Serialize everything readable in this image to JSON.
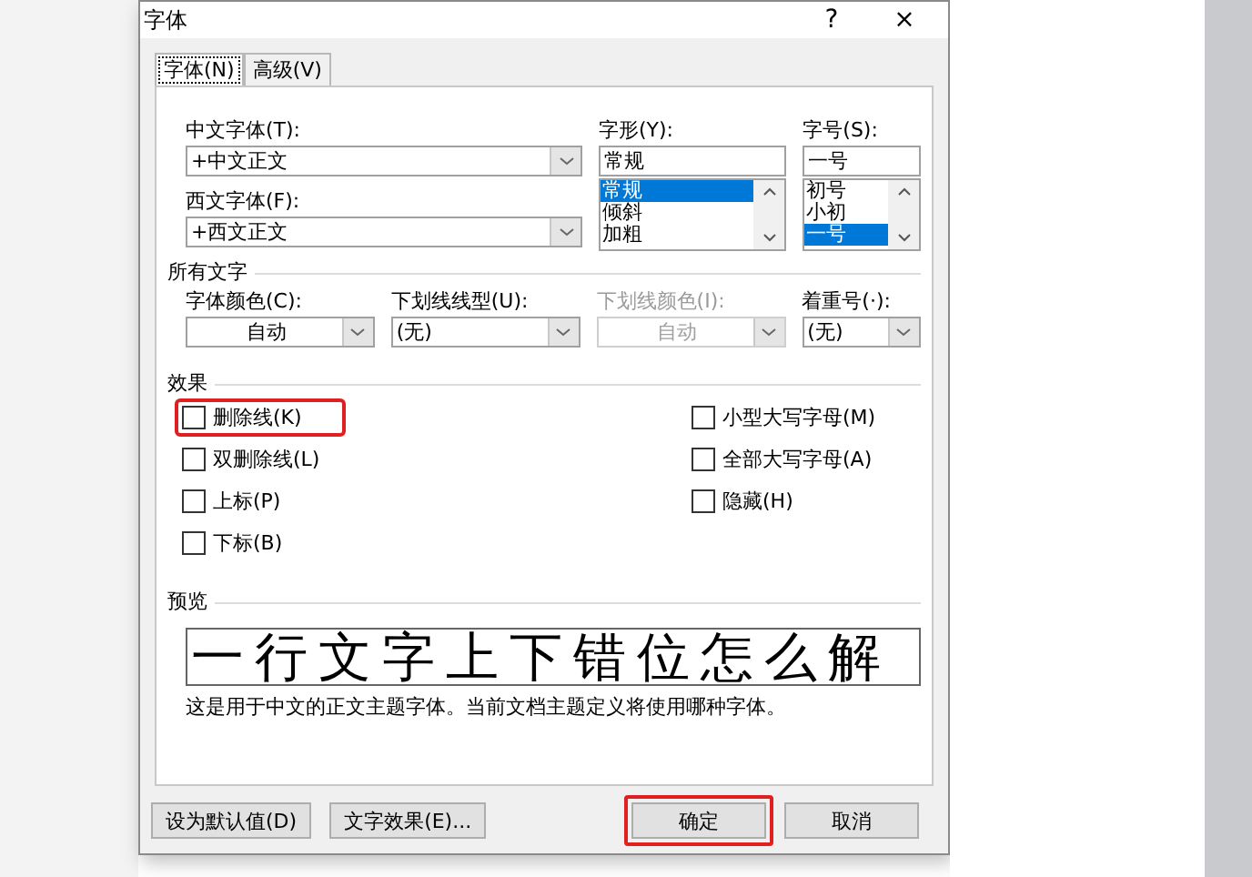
{
  "window": {
    "title": "字体",
    "help": "?",
    "close": "×"
  },
  "tabs": [
    {
      "label": "字体(N)",
      "selected": true
    },
    {
      "label": "高级(V)",
      "selected": false
    }
  ],
  "fonts": {
    "chinese": {
      "label": "中文字体(T):",
      "value": "+中文正文"
    },
    "western": {
      "label": "西文字体(F):",
      "value": "+西文正文"
    },
    "style": {
      "label": "字形(Y):",
      "value": "常规",
      "options": [
        {
          "label": "常规",
          "selected": true
        },
        {
          "label": "倾斜",
          "selected": false
        },
        {
          "label": "加粗",
          "selected": false
        }
      ]
    },
    "size": {
      "label": "字号(S):",
      "value": "一号",
      "options": [
        {
          "label": "初号",
          "selected": false
        },
        {
          "label": "小初",
          "selected": false
        },
        {
          "label": "一号",
          "selected": true
        }
      ]
    }
  },
  "all_text": {
    "heading": "所有文字",
    "fields": [
      {
        "label": "字体颜色(C):",
        "value": "自动",
        "disabled": false,
        "centered": true
      },
      {
        "label": "下划线线型(U):",
        "value": "(无)",
        "disabled": false,
        "centered": false
      },
      {
        "label": "下划线颜色(I):",
        "value": "自动",
        "disabled": true,
        "centered": true
      },
      {
        "label": "着重号(·):",
        "value": "(无)",
        "disabled": false,
        "centered": false
      }
    ]
  },
  "effects": {
    "heading": "效果",
    "left": [
      {
        "label": "删除线(K)",
        "checked": false,
        "highlighted": true
      },
      {
        "label": "双删除线(L)",
        "checked": false,
        "highlighted": false
      },
      {
        "label": "上标(P)",
        "checked": false,
        "highlighted": false
      },
      {
        "label": "下标(B)",
        "checked": false,
        "highlighted": false
      }
    ],
    "right": [
      {
        "label": "小型大写字母(M)",
        "checked": false,
        "highlighted": false
      },
      {
        "label": "全部大写字母(A)",
        "checked": false,
        "highlighted": false
      },
      {
        "label": "隐藏(H)",
        "checked": false,
        "highlighted": false
      }
    ]
  },
  "preview": {
    "heading": "预览",
    "sample": "一行文字上下错位怎么解",
    "description": "这是用于中文的正文主题字体。当前文档主题定义将使用哪种字体。"
  },
  "buttons": [
    {
      "label": "设为默认值(D)",
      "kind": "secondary",
      "highlighted": false
    },
    {
      "label": "文字效果(E)...",
      "kind": "secondary",
      "highlighted": false
    },
    {
      "label": "确定",
      "kind": "primary",
      "highlighted": true
    },
    {
      "label": "取消",
      "kind": "primary",
      "highlighted": false
    }
  ]
}
